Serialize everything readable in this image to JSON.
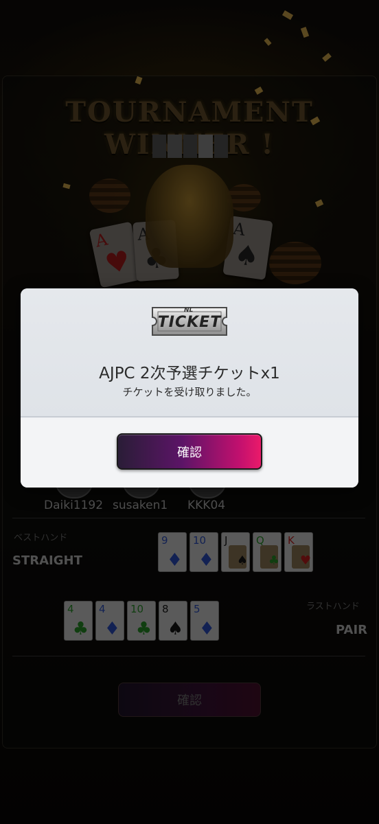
{
  "winner": {
    "title": "TOURNAMENT WINNER !"
  },
  "players": [
    {
      "name": "Daiki1192"
    },
    {
      "name": "susaken1"
    },
    {
      "name": "KKK04"
    }
  ],
  "best_hand": {
    "label": "ベストハンド",
    "name": "STRAIGHT",
    "cards": [
      {
        "rank": "9",
        "suit": "♦",
        "color": "blue"
      },
      {
        "rank": "10",
        "suit": "♦",
        "color": "blue"
      },
      {
        "rank": "J",
        "suit": "♠",
        "color": "black"
      },
      {
        "rank": "Q",
        "suit": "♣",
        "color": "green"
      },
      {
        "rank": "K",
        "suit": "♥",
        "color": "red"
      }
    ]
  },
  "last_hand": {
    "label": "ラストハンド",
    "name": "PAIR",
    "cards": [
      {
        "rank": "4",
        "suit": "♣",
        "color": "green"
      },
      {
        "rank": "4",
        "suit": "♦",
        "color": "blue"
      },
      {
        "rank": "10",
        "suit": "♣",
        "color": "green"
      },
      {
        "rank": "8",
        "suit": "♠",
        "color": "black"
      },
      {
        "rank": "5",
        "suit": "♦",
        "color": "blue"
      }
    ]
  },
  "background_confirm_label": "確認",
  "modal": {
    "ticket_badge": "TICKET",
    "ticket_logo": "NL",
    "title": "AJPC 2次予選チケットx1",
    "subtitle": "チケットを受け取りました。",
    "confirm_label": "確認"
  },
  "colors": {
    "accent_start": "#2a1d37",
    "accent_end": "#ea1a6a",
    "modal_bg": "#e5e8ec"
  }
}
